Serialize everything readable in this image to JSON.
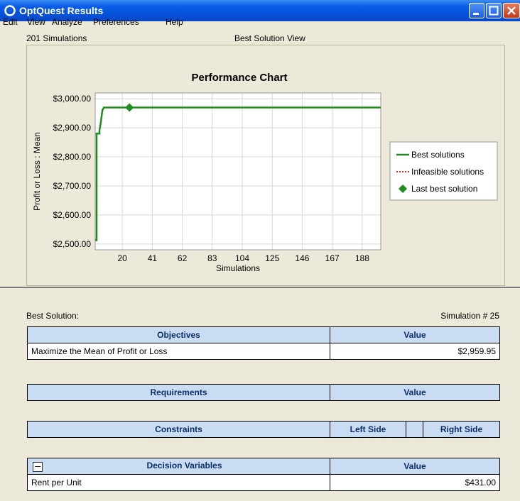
{
  "window": {
    "title": "OptQuest Results"
  },
  "menu": [
    "Edit",
    "View",
    "Analyze",
    "Preferences",
    "Help"
  ],
  "header": {
    "simulations": "201 Simulations",
    "view": "Best Solution View"
  },
  "chart_data": {
    "type": "line",
    "title": "Performance Chart",
    "xlabel": "Simulations",
    "ylabel": "Profit or Loss : Mean",
    "x_ticks": [
      "20",
      "41",
      "62",
      "83",
      "104",
      "125",
      "146",
      "167",
      "188"
    ],
    "y_ticks": [
      "$2,500.00",
      "$2,600.00",
      "$2,700.00",
      "$2,800.00",
      "$2,900.00",
      "$3,000.00"
    ],
    "xlim": [
      1,
      201
    ],
    "ylim": [
      2480,
      3020
    ],
    "grid": true,
    "legend_position": "right",
    "series": [
      {
        "name": "Best solutions",
        "color": "#1e8c1e",
        "x": [
          1,
          2,
          2,
          3,
          4,
          4,
          5,
          6,
          7,
          8,
          201
        ],
        "y": [
          2513,
          2513,
          2880,
          2880,
          2880,
          2890,
          2920,
          2960,
          2970,
          2970,
          2970
        ]
      },
      {
        "name": "Infeasible solutions",
        "color": "#e0302a",
        "x": [],
        "y": []
      }
    ],
    "markers": [
      {
        "name": "Last best solution",
        "x": 25,
        "y": 2970,
        "color": "#1e8c1e"
      }
    ]
  },
  "best_solution": {
    "label": "Best Solution:",
    "simulation": "Simulation # 25",
    "objectives": {
      "headers": [
        "Objectives",
        "Value"
      ],
      "rows": [
        [
          "Maximize the Mean of Profit or Loss",
          "$2,959.95"
        ]
      ]
    },
    "requirements": {
      "headers": [
        "Requirements",
        "Value"
      ]
    },
    "constraints": {
      "headers": [
        "Constraints",
        "Left Side",
        "Right Side"
      ]
    },
    "decision_variables": {
      "headers": [
        "Decision Variables",
        "Value"
      ],
      "rows": [
        [
          "Rent per Unit",
          "$431.00"
        ]
      ]
    }
  }
}
